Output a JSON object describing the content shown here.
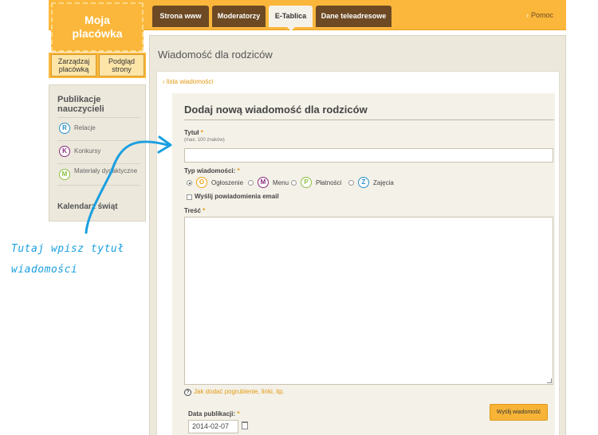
{
  "brand": {
    "line1": "Moja",
    "line2": "placówka"
  },
  "sub_buttons": [
    {
      "line1": "Zarządzaj",
      "line2": "placówką"
    },
    {
      "line1": "Podgląd",
      "line2": "strony"
    }
  ],
  "tabs": [
    {
      "label": "Strona www"
    },
    {
      "label": "Moderatorzy"
    },
    {
      "label": "E-Tablica"
    },
    {
      "label": "Dane teleadresowe"
    }
  ],
  "help_label": "Pomoc",
  "sidebar": {
    "title": "Publikacje nauczycieli",
    "items": [
      {
        "letter": "R",
        "label": "Relacje",
        "color": "#2a8fc9"
      },
      {
        "letter": "K",
        "label": "Konkursy",
        "color": "#8b2a7e"
      },
      {
        "letter": "M",
        "label": "Materiały dydaktyczne",
        "color": "#8bbf3f"
      }
    ],
    "calendar": "Kalendarz świąt"
  },
  "page": {
    "title": "Wiadomość dla rodziców",
    "back_link": "‹ lista wiadomości",
    "form_title": "Dodaj nową wiadomość dla rodziców",
    "title_label": "Tytuł",
    "required_mark": "*",
    "title_hint": "(max. 100 znaków)",
    "type_label": "Typ wiadomości:",
    "types": [
      {
        "letter": "O",
        "label": "Ogłoszenie",
        "color": "#f0a21a",
        "selected": true
      },
      {
        "letter": "M",
        "label": "Menu",
        "color": "#8b2a7e",
        "selected": false
      },
      {
        "letter": "P",
        "label": "Płatności",
        "color": "#8bbf3f",
        "selected": false
      },
      {
        "letter": "Z",
        "label": "Zajęcia",
        "color": "#2a8fc9",
        "selected": false
      }
    ],
    "notify_label": "Wyślij powiadomienia email",
    "content_label": "Treść",
    "format_help": "Jak dodać pogrubienie, linki, itp.",
    "pub_date_label": "Data publikacji:",
    "pub_date_value": "2014-02-07",
    "submit_label": "Wyślij wiadomość"
  },
  "annotation": {
    "line1": "Tutaj wpisz tytuł",
    "line2": "wiadomości",
    "color": "#1a9fe0"
  }
}
